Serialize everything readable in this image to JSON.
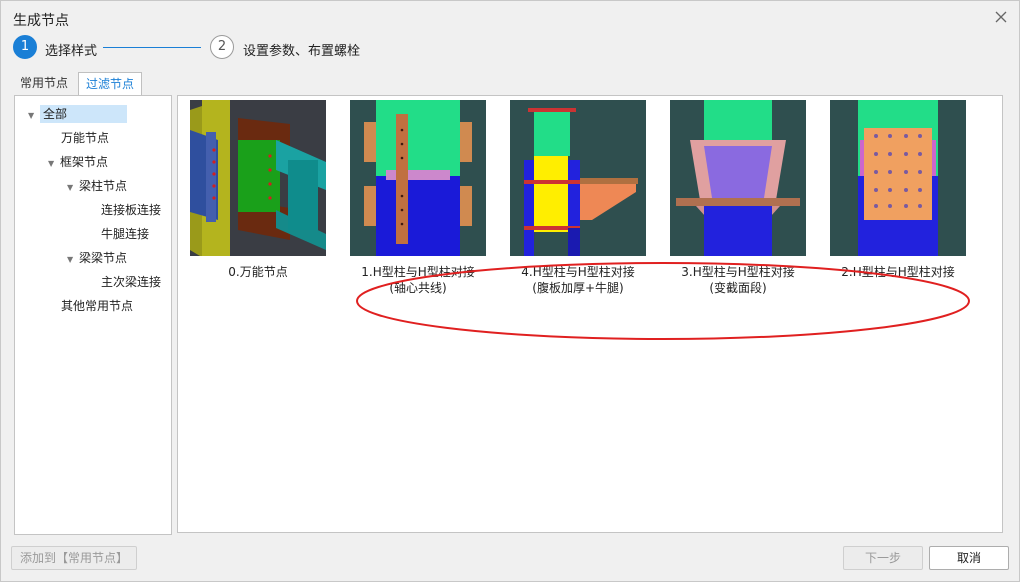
{
  "window": {
    "title": "生成节点"
  },
  "steps": [
    {
      "number": "1",
      "label": "选择样式"
    },
    {
      "number": "2",
      "label": "设置参数、布置螺栓"
    }
  ],
  "tabs": [
    {
      "label": "常用节点"
    },
    {
      "label": "过滤节点"
    }
  ],
  "tree": [
    {
      "label": "全部"
    },
    {
      "label": "万能节点"
    },
    {
      "label": "框架节点"
    },
    {
      "label": "梁柱节点"
    },
    {
      "label": "连接板连接"
    },
    {
      "label": "牛腿连接"
    },
    {
      "label": "梁梁节点"
    },
    {
      "label": "主次梁连接"
    },
    {
      "label": "其他常用节点"
    }
  ],
  "nodes": [
    {
      "line1": "0.万能节点",
      "line2": ""
    },
    {
      "line1": "1.H型柱与H型柱对接",
      "line2": "(轴心共线)"
    },
    {
      "line1": "4.H型柱与H型柱对接",
      "line2": "(腹板加厚+牛腿)"
    },
    {
      "line1": "3.H型柱与H型柱对接",
      "line2": "(变截面段)"
    },
    {
      "line1": "2.H型柱与H型柱对接",
      "line2": ""
    }
  ],
  "buttons": {
    "add": "添加到【常用节点】",
    "next": "下一步",
    "cancel": "取消"
  },
  "colors": {
    "accent": "#1a7fd6",
    "annotation": "#e02020",
    "selection": "#cde6fa"
  }
}
